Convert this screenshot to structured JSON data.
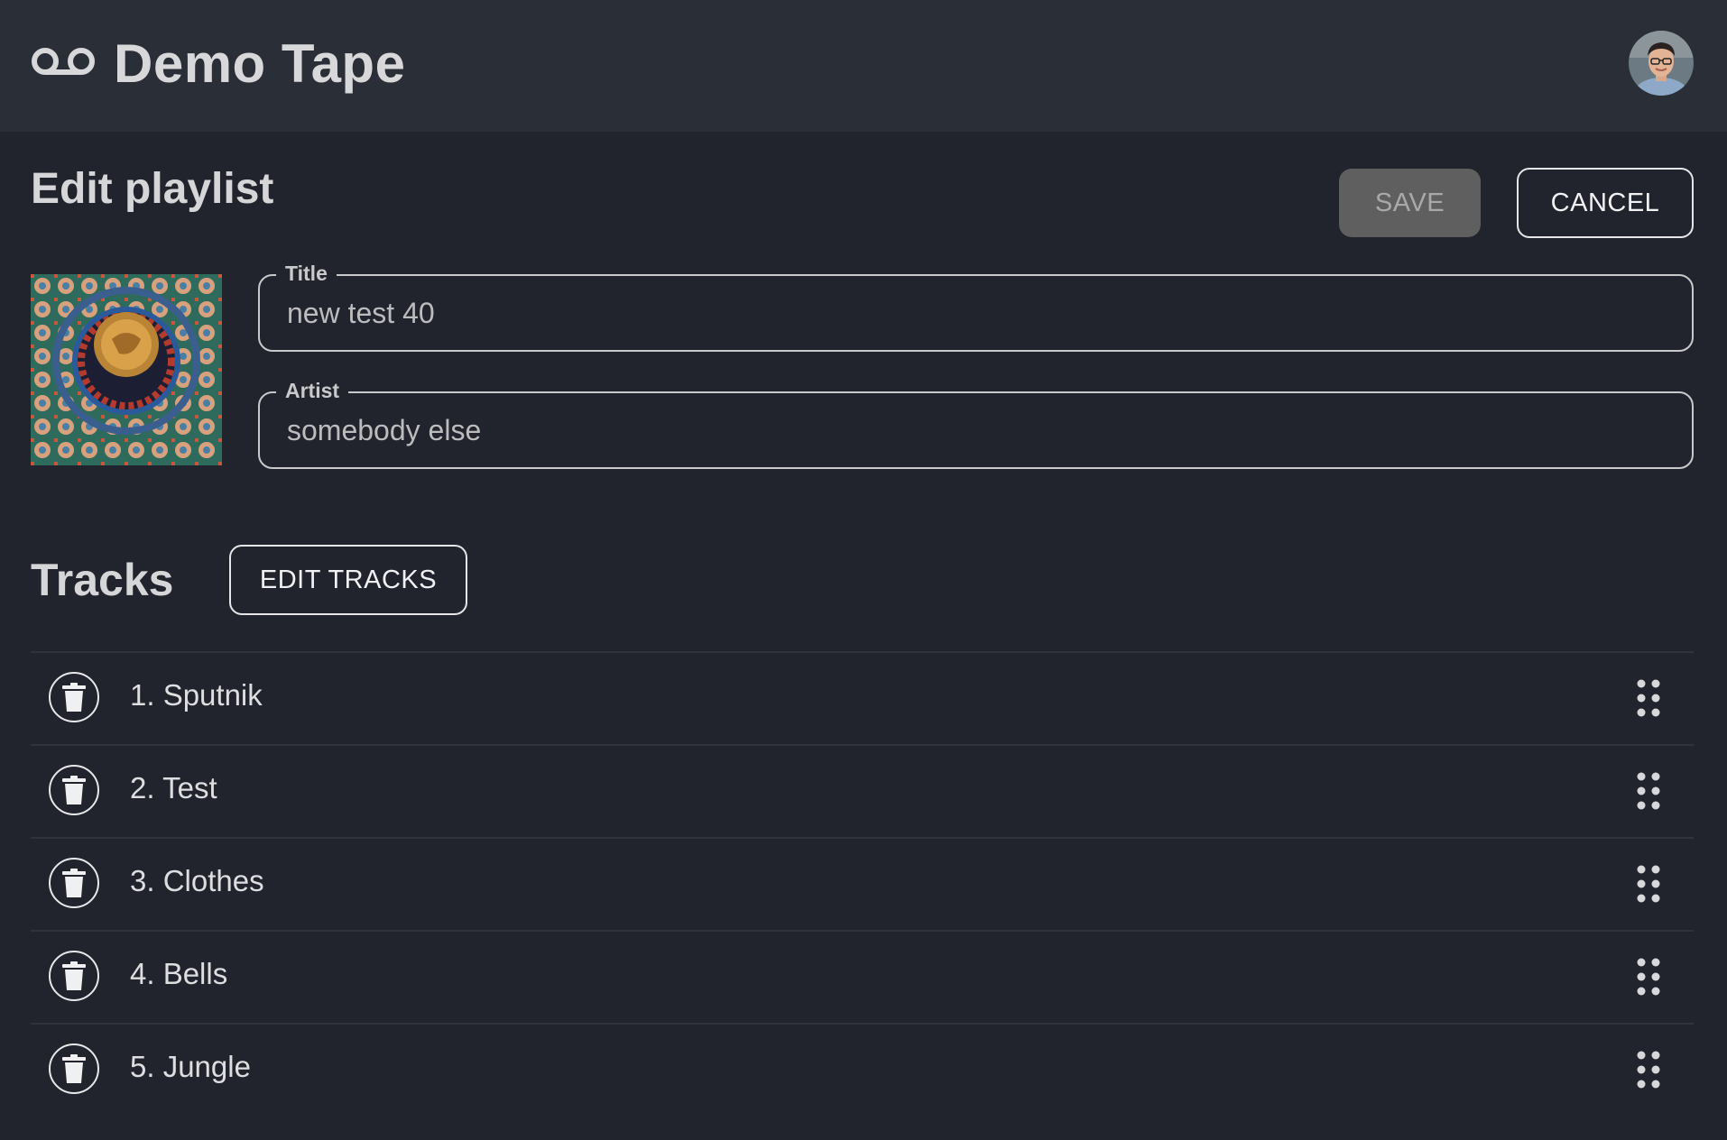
{
  "app": {
    "title": "Demo Tape",
    "logo_icon": "voicemail-icon",
    "avatar": "user-avatar"
  },
  "colors": {
    "background": "#21242c",
    "topbar": "#2a2e37",
    "save_disabled": "#5f5f60",
    "outline": "#e6e6e8"
  },
  "page": {
    "title": "Edit playlist"
  },
  "actions": {
    "save_label": "SAVE",
    "cancel_label": "CANCEL"
  },
  "form": {
    "title_label": "Title",
    "title_value": "new test 40",
    "artist_label": "Artist",
    "artist_value": "somebody else"
  },
  "tracks": {
    "heading": "Tracks",
    "edit_label": "EDIT TRACKS",
    "items": [
      {
        "label": "1. Sputnik"
      },
      {
        "label": "2. Test"
      },
      {
        "label": "3. Clothes"
      },
      {
        "label": "4. Bells"
      },
      {
        "label": "5. Jungle"
      }
    ]
  }
}
